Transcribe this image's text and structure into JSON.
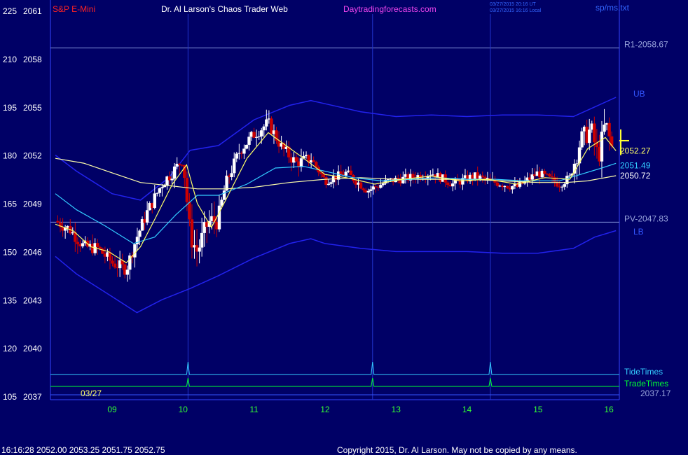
{
  "header": {
    "instrument": "S&P E-Mini",
    "site_title": "Dr. Al Larson's Chaos Trader Web",
    "site_link": "Daytradingforecasts.com",
    "timestamp_ut": "03/27/2015 20:16 UT",
    "timestamp_local": "03/27/2015 16:16 Local",
    "filename": "sp/ms.txt"
  },
  "footer": {
    "quote": "16:16:28  2052.00 2053.25 2051.75 2052.75",
    "copyright": "Copyright 2015, Dr. Al Larson. May not be copied by any means.",
    "date_label": "03/27"
  },
  "colors": {
    "background": "#000066",
    "up_candle": "#ffffff",
    "down_candle": "#cc0000",
    "band": "#2222ee",
    "ma_fast": "#ffff66",
    "ma_mid": "#33ccff",
    "ma_slow": "#ffffaa",
    "tide": "#33ccff",
    "trade": "#00ff33",
    "level_line": "#8899dd"
  },
  "chart_data": {
    "type": "candlestick",
    "x_ticks": [
      "09",
      "10",
      "11",
      "12",
      "13",
      "14",
      "15",
      "16"
    ],
    "x_range": [
      8.2,
      16.1
    ],
    "y_ticks": [
      {
        "left": "225",
        "right": "2061",
        "price": 2061
      },
      {
        "left": "210",
        "right": "2058",
        "price": 2058
      },
      {
        "left": "195",
        "right": "2055",
        "price": 2055
      },
      {
        "left": "180",
        "right": "2052",
        "price": 2052
      },
      {
        "left": "165",
        "right": "2049",
        "price": 2049
      },
      {
        "left": "150",
        "right": "2046",
        "price": 2046
      },
      {
        "left": "135",
        "right": "2043",
        "price": 2043
      },
      {
        "left": "120",
        "right": "2040",
        "price": 2040
      },
      {
        "left": "105",
        "right": "2037",
        "price": 2037
      }
    ],
    "y_range": [
      2037,
      2061
    ],
    "levels": [
      {
        "label": "R1-2058.67",
        "price": 2058.67
      },
      {
        "label": "PV-2047.83",
        "price": 2047.83
      },
      {
        "label": "2037.17",
        "price": 2037.17
      }
    ],
    "band_labels": [
      "UB",
      "LB"
    ],
    "last_values": [
      {
        "label": "2052.27",
        "price": 2052.27,
        "color": "#ffff66"
      },
      {
        "label": "2051.49",
        "price": 2051.49,
        "color": "#33ccff"
      },
      {
        "label": "2050.72",
        "price": 2050.72,
        "color": "#ffffff"
      }
    ],
    "tide_label": "TideTimes",
    "trade_label": "TradeTimes",
    "time_markers": [
      10.07,
      12.67,
      14.33
    ],
    "close_path": [
      [
        8.2,
        2047.9
      ],
      [
        8.4,
        2047.4
      ],
      [
        8.6,
        2046.3
      ],
      [
        8.8,
        2046.2
      ],
      [
        9.0,
        2045.3
      ],
      [
        9.2,
        2044.9
      ],
      [
        9.35,
        2046.9
      ],
      [
        9.5,
        2048.5
      ],
      [
        9.7,
        2050.2
      ],
      [
        9.9,
        2051.2
      ],
      [
        10.0,
        2051.8
      ],
      [
        10.1,
        2047.0
      ],
      [
        10.2,
        2046.0
      ],
      [
        10.35,
        2047.8
      ],
      [
        10.5,
        2048.0
      ],
      [
        10.6,
        2050.2
      ],
      [
        10.8,
        2052.3
      ],
      [
        11.0,
        2053.3
      ],
      [
        11.2,
        2054.0
      ],
      [
        11.4,
        2052.4
      ],
      [
        11.6,
        2051.5
      ],
      [
        11.8,
        2051.8
      ],
      [
        12.0,
        2050.4
      ],
      [
        12.3,
        2050.9
      ],
      [
        12.6,
        2049.8
      ],
      [
        12.9,
        2050.4
      ],
      [
        13.2,
        2050.6
      ],
      [
        13.5,
        2050.9
      ],
      [
        13.8,
        2050.2
      ],
      [
        14.1,
        2050.7
      ],
      [
        14.4,
        2050.3
      ],
      [
        14.7,
        2050.0
      ],
      [
        15.0,
        2050.9
      ],
      [
        15.3,
        2050.2
      ],
      [
        15.45,
        2050.6
      ],
      [
        15.6,
        2052.9
      ],
      [
        15.75,
        2053.6
      ],
      [
        15.85,
        2051.8
      ],
      [
        15.95,
        2054.0
      ],
      [
        16.05,
        2052.3
      ]
    ],
    "ub_path": [
      [
        8.2,
        2052.0
      ],
      [
        8.5,
        2051.0
      ],
      [
        9.0,
        2049.6
      ],
      [
        9.4,
        2049.2
      ],
      [
        9.8,
        2050.6
      ],
      [
        10.1,
        2052.3
      ],
      [
        10.5,
        2052.6
      ],
      [
        11.0,
        2054.2
      ],
      [
        11.5,
        2055.1
      ],
      [
        11.8,
        2055.4
      ],
      [
        12.0,
        2055.2
      ],
      [
        12.5,
        2054.7
      ],
      [
        13.0,
        2054.4
      ],
      [
        13.5,
        2054.5
      ],
      [
        14.0,
        2054.4
      ],
      [
        14.5,
        2054.5
      ],
      [
        15.0,
        2054.5
      ],
      [
        15.5,
        2054.4
      ],
      [
        15.8,
        2055.0
      ],
      [
        16.1,
        2055.6
      ]
    ],
    "lb_path": [
      [
        8.2,
        2045.7
      ],
      [
        8.5,
        2044.6
      ],
      [
        9.0,
        2043.2
      ],
      [
        9.35,
        2042.2
      ],
      [
        9.7,
        2043.0
      ],
      [
        10.1,
        2043.7
      ],
      [
        10.5,
        2044.5
      ],
      [
        11.0,
        2045.6
      ],
      [
        11.5,
        2046.5
      ],
      [
        11.8,
        2046.8
      ],
      [
        12.0,
        2046.5
      ],
      [
        12.5,
        2046.2
      ],
      [
        13.0,
        2046.0
      ],
      [
        13.5,
        2046.0
      ],
      [
        14.0,
        2046.0
      ],
      [
        14.5,
        2045.9
      ],
      [
        15.0,
        2045.9
      ],
      [
        15.5,
        2046.2
      ],
      [
        15.8,
        2046.9
      ],
      [
        16.1,
        2047.3
      ]
    ],
    "ma_slow_path": [
      [
        8.2,
        2051.8
      ],
      [
        8.6,
        2051.5
      ],
      [
        9.0,
        2050.9
      ],
      [
        9.4,
        2050.3
      ],
      [
        9.8,
        2050.1
      ],
      [
        10.2,
        2049.9
      ],
      [
        10.6,
        2049.9
      ],
      [
        11.0,
        2050.0
      ],
      [
        11.5,
        2050.3
      ],
      [
        12.0,
        2050.5
      ],
      [
        12.5,
        2050.6
      ],
      [
        13.0,
        2050.5
      ],
      [
        13.5,
        2050.5
      ],
      [
        14.0,
        2050.5
      ],
      [
        14.5,
        2050.4
      ],
      [
        15.0,
        2050.3
      ],
      [
        15.4,
        2050.3
      ],
      [
        15.7,
        2050.4
      ],
      [
        16.1,
        2050.72
      ]
    ],
    "ma_mid_path": [
      [
        8.2,
        2049.6
      ],
      [
        8.5,
        2048.6
      ],
      [
        8.9,
        2047.6
      ],
      [
        9.3,
        2046.5
      ],
      [
        9.6,
        2046.9
      ],
      [
        9.9,
        2048.3
      ],
      [
        10.2,
        2049.5
      ],
      [
        10.5,
        2049.5
      ],
      [
        10.9,
        2050.2
      ],
      [
        11.3,
        2051.2
      ],
      [
        11.7,
        2051.3
      ],
      [
        12.0,
        2051.0
      ],
      [
        12.4,
        2050.6
      ],
      [
        12.8,
        2050.4
      ],
      [
        13.2,
        2050.5
      ],
      [
        13.6,
        2050.6
      ],
      [
        14.0,
        2050.5
      ],
      [
        14.4,
        2050.5
      ],
      [
        14.8,
        2050.4
      ],
      [
        15.3,
        2050.4
      ],
      [
        15.6,
        2050.8
      ],
      [
        15.9,
        2051.2
      ],
      [
        16.1,
        2051.49
      ]
    ],
    "ma_fast_path": [
      [
        8.2,
        2047.7
      ],
      [
        8.45,
        2047.3
      ],
      [
        8.7,
        2046.3
      ],
      [
        8.95,
        2046.0
      ],
      [
        9.2,
        2045.3
      ],
      [
        9.4,
        2046.3
      ],
      [
        9.6,
        2048.0
      ],
      [
        9.85,
        2050.2
      ],
      [
        10.05,
        2051.4
      ],
      [
        10.2,
        2049.0
      ],
      [
        10.4,
        2047.5
      ],
      [
        10.6,
        2049.2
      ],
      [
        10.9,
        2051.8
      ],
      [
        11.2,
        2053.4
      ],
      [
        11.45,
        2052.6
      ],
      [
        11.7,
        2051.8
      ],
      [
        12.0,
        2050.8
      ],
      [
        12.3,
        2050.6
      ],
      [
        12.7,
        2050.2
      ],
      [
        13.1,
        2050.5
      ],
      [
        13.5,
        2050.7
      ],
      [
        13.9,
        2050.4
      ],
      [
        14.3,
        2050.5
      ],
      [
        14.7,
        2050.2
      ],
      [
        15.1,
        2050.6
      ],
      [
        15.45,
        2050.5
      ],
      [
        15.7,
        2052.4
      ],
      [
        15.95,
        2053.1
      ],
      [
        16.1,
        2052.27
      ]
    ]
  }
}
